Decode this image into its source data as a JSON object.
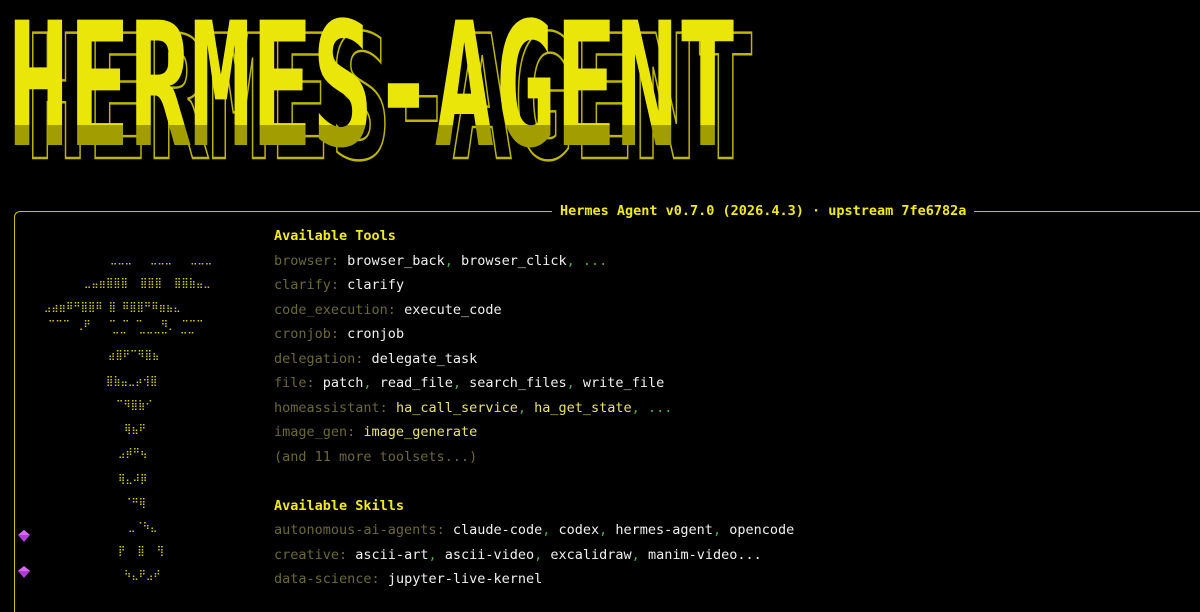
{
  "banner": {
    "text": "HERMES-AGENT",
    "color": "#ebe60a",
    "shadow_color": "#a29d00"
  },
  "panel": {
    "title": "Hermes Agent v0.7.0 (2026.4.3) · upstream 7fe6782a",
    "border_color": "#c9c300"
  },
  "tools": {
    "heading": "Available Tools",
    "rows": [
      {
        "category": "browser",
        "items": [
          {
            "text": "browser_back"
          },
          {
            "text": "browser_click"
          },
          {
            "text": "...",
            "ellipsis": true
          }
        ]
      },
      {
        "category": "clarify",
        "items": [
          {
            "text": "clarify"
          }
        ]
      },
      {
        "category": "code_execution",
        "items": [
          {
            "text": "execute_code"
          }
        ]
      },
      {
        "category": "cronjob",
        "items": [
          {
            "text": "cronjob"
          }
        ]
      },
      {
        "category": "delegation",
        "items": [
          {
            "text": "delegate_task"
          }
        ]
      },
      {
        "category": "file",
        "items": [
          {
            "text": "patch"
          },
          {
            "text": "read_file"
          },
          {
            "text": "search_files"
          },
          {
            "text": "write_file"
          }
        ]
      },
      {
        "category": "homeassistant",
        "items": [
          {
            "text": "ha_call_service",
            "highlight": true
          },
          {
            "text": "ha_get_state",
            "highlight": true
          },
          {
            "text": "...",
            "ellipsis": true
          }
        ]
      },
      {
        "category": "image_gen",
        "items": [
          {
            "text": "image_generate",
            "highlight": true
          }
        ]
      }
    ],
    "more": "(and 11 more toolsets...)"
  },
  "skills": {
    "heading": "Available Skills",
    "rows": [
      {
        "category": "autonomous-ai-agents",
        "items": [
          {
            "text": "claude-code"
          },
          {
            "text": "codex"
          },
          {
            "text": "hermes-agent"
          },
          {
            "text": "opencode"
          }
        ]
      },
      {
        "category": "creative",
        "items": [
          {
            "text": "ascii-art"
          },
          {
            "text": "ascii-video"
          },
          {
            "text": "excalidraw"
          },
          {
            "text": "manim-video..."
          }
        ]
      },
      {
        "category": "data-science",
        "items": [
          {
            "text": "jupyter-live-kernel"
          }
        ]
      }
    ]
  },
  "icons": {
    "gem_1": "purple-gem-icon",
    "gem_2": "purple-gem-icon"
  },
  "colors": {
    "accent_yellow": "#f1ea1e",
    "category_dim": "#6b6838",
    "separator_green": "#4caf50",
    "gem_purple": "#b23cd8"
  }
}
